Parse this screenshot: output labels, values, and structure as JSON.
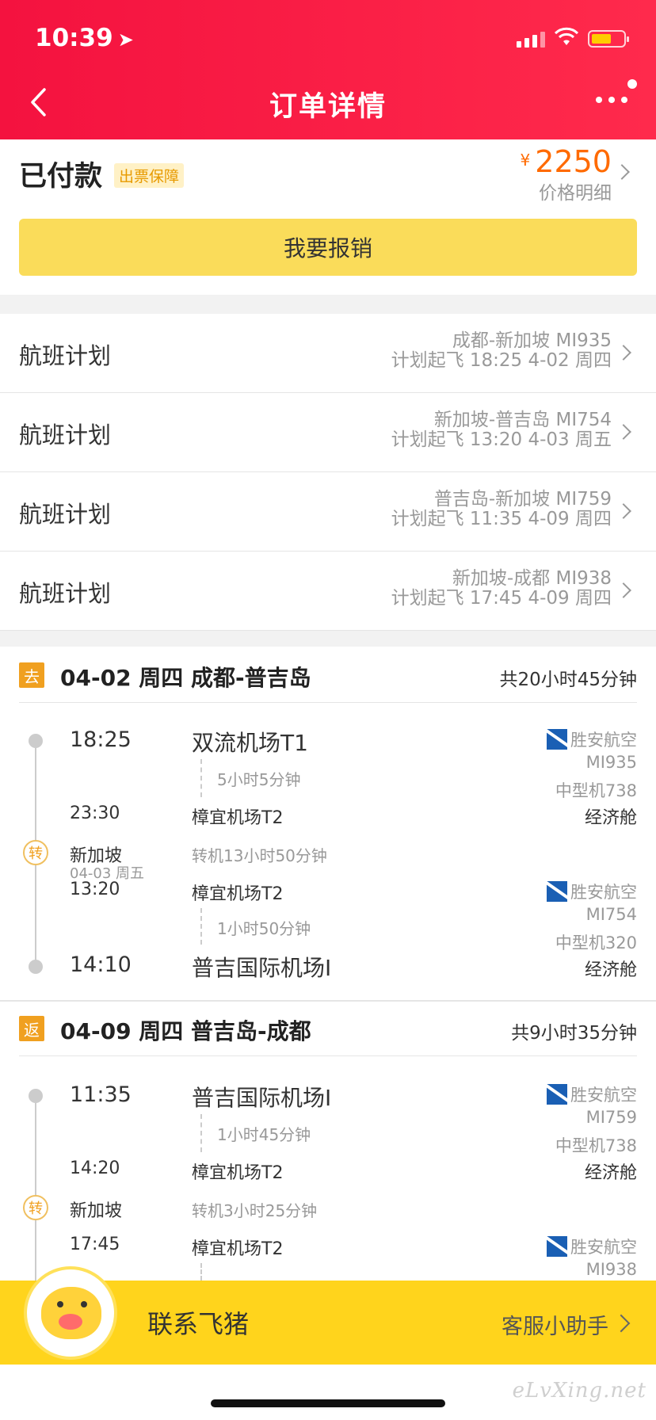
{
  "status_bar": {
    "time": "10:39"
  },
  "header": {
    "title": "订单详情"
  },
  "summary": {
    "status": "已付款",
    "badge": "出票保障",
    "currency": "¥",
    "price": "2250",
    "price_detail": "价格明细",
    "reimburse_button": "我要报销"
  },
  "plans": [
    {
      "label": "航班计划",
      "route": "成都-新加坡 MI935",
      "time": "计划起飞 18:25 4-02 周四"
    },
    {
      "label": "航班计划",
      "route": "新加坡-普吉岛 MI754",
      "time": "计划起飞 13:20 4-03 周五"
    },
    {
      "label": "航班计划",
      "route": "普吉岛-新加坡 MI759",
      "time": "计划起飞 11:35 4-09 周四"
    },
    {
      "label": "航班计划",
      "route": "新加坡-成都 MI938",
      "time": "计划起飞 17:45 4-09 周四"
    }
  ],
  "outbound": {
    "tag": "去",
    "title": "04-02 周四 成都-普吉岛",
    "total": "共20小时45分钟",
    "seg1": {
      "dep_time": "18:25",
      "dep_airport": "双流机场T1",
      "duration": "5小时5分钟",
      "arr_time": "23:30",
      "arr_airport": "樟宜机场T2",
      "airline": "胜安航空",
      "flight_no": "MI935",
      "aircraft": "中型机738",
      "cabin": "经济舱"
    },
    "transfer": {
      "icon_text": "转",
      "city": "新加坡",
      "date": "04-03 周五",
      "text": "转机13小时50分钟"
    },
    "seg2": {
      "dep_time": "13:20",
      "dep_airport": "樟宜机场T2",
      "duration": "1小时50分钟",
      "arr_time": "14:10",
      "arr_airport": "普吉国际机场I",
      "airline": "胜安航空",
      "flight_no": "MI754",
      "aircraft": "中型机320",
      "cabin": "经济舱"
    }
  },
  "return": {
    "tag": "返",
    "title": "04-09 周四 普吉岛-成都",
    "total": "共9小时35分钟",
    "seg1": {
      "dep_time": "11:35",
      "dep_airport": "普吉国际机场I",
      "duration": "1小时45分钟",
      "arr_time": "14:20",
      "arr_airport": "樟宜机场T2",
      "airline": "胜安航空",
      "flight_no": "MI759",
      "aircraft": "中型机738",
      "cabin": "经济舱"
    },
    "transfer": {
      "icon_text": "转",
      "city": "新加坡",
      "text": "转机3小时25分钟"
    },
    "seg2": {
      "dep_time": "17:45",
      "dep_airport": "樟宜机场T2",
      "airline": "胜安航空",
      "flight_no": "MI938"
    }
  },
  "bottom_bar": {
    "contact": "联系飞猪",
    "assistant": "客服小助手"
  },
  "watermark": "eLvXing.net",
  "colors": {
    "header": "#f4123f",
    "accent_price": "#ff6a00",
    "button": "#fadc5a",
    "bottom_bar": "#ffd41c",
    "tag": "#f0a020"
  }
}
